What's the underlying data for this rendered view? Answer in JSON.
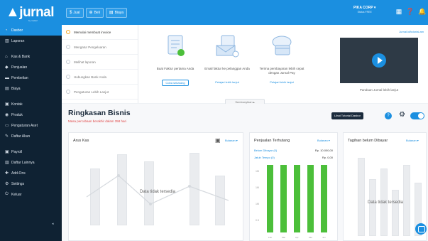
{
  "logo": {
    "text": "jurnal",
    "tagline": "by mekari"
  },
  "topbar": {
    "buttons": [
      {
        "icon": "$",
        "label": "Jual"
      },
      {
        "icon": "⊕",
        "label": "Beli"
      },
      {
        "icon": "▤",
        "label": "Biaya"
      }
    ],
    "company": "PIKA CORP ▾",
    "company_sub": "Status FREE"
  },
  "sidebar": {
    "items": [
      {
        "label": "Dasbor",
        "icon": "dashboard-icon"
      },
      {
        "label": "Laporan",
        "icon": "report-icon"
      },
      {
        "label": "Kas & Bank",
        "icon": "bank-icon"
      },
      {
        "label": "Penjualan",
        "icon": "sales-icon"
      },
      {
        "label": "Pembelian",
        "icon": "purchase-icon"
      },
      {
        "label": "Biaya",
        "icon": "expense-icon"
      },
      {
        "label": "Kontak",
        "icon": "contact-icon"
      },
      {
        "label": "Produk",
        "icon": "product-icon"
      },
      {
        "label": "Pengaturan Aset",
        "icon": "asset-icon"
      },
      {
        "label": "Daftar Akun",
        "icon": "account-icon"
      },
      {
        "label": "Payroll",
        "icon": "payroll-icon"
      },
      {
        "label": "Daftar Lainnya",
        "icon": "list-icon"
      },
      {
        "label": "Add-Ons",
        "icon": "addon-icon"
      },
      {
        "label": "Settings",
        "icon": "settings-icon"
      },
      {
        "label": "Keluar",
        "icon": "logout-icon"
      }
    ],
    "collapse": "◂"
  },
  "onboarding": {
    "steps": [
      "Memulai membuat invoice",
      "Mengatur Pengeluaran",
      "Melihat laporan",
      "Hubungkan Bank Anda",
      "Pengaturan Lebih Lanjut"
    ],
    "cards": [
      {
        "text": "Buat Faktur pertama Anda",
        "action": "Coba sekarang"
      },
      {
        "text": "Email faktur ke pelanggan Anda",
        "action": "Pelajari lebih lanjut"
      },
      {
        "text": "Terima pembayaran lebih cepat dengan Jurnal Pay",
        "action": "Pelajari lebih lanjut"
      }
    ],
    "video_caption": "Panduan Jurnal lebih lanjut",
    "tutorial_link": "Jurnal.id/tutorial.am",
    "more_label": "Sembunyikan ▴"
  },
  "summary": {
    "title": "Ringkasan Bisnis",
    "trial": "Masa percobaan berakhir dalam 358 hari",
    "tutorial_button": "Lihat Tutorial Dasbor",
    "help_badge": "?"
  },
  "panels": {
    "kas": {
      "title": "Arus Kas",
      "select": "Bulanan ▾",
      "nodata": "Data tidak tersedia"
    },
    "penjualan": {
      "title": "Penjualan Terhutang",
      "select": "Bulanan ▾",
      "rows": [
        {
          "label": "Belum Dibayar (0)",
          "value": "Rp. 10.000,00"
        },
        {
          "label": "Jatuh Tempo (0)",
          "value": "Rp. 0,00"
        }
      ]
    },
    "tagihan": {
      "title": "Tagihan belum Dibayar",
      "select": "Bulanan ▾",
      "nodata": "Data tidak tersedia"
    }
  },
  "chart_data": {
    "type": "bar",
    "categories": [
      "",
      "",
      "",
      "",
      ""
    ],
    "values": [
      0,
      0,
      0,
      0,
      0
    ],
    "title": "Penjualan Terhutang",
    "color": "#4cbf3a"
  },
  "colors": {
    "primary": "#1b8fe0",
    "sidebar": "#0f2233",
    "alert": "#e04848",
    "bar": "#4cbf3a"
  }
}
